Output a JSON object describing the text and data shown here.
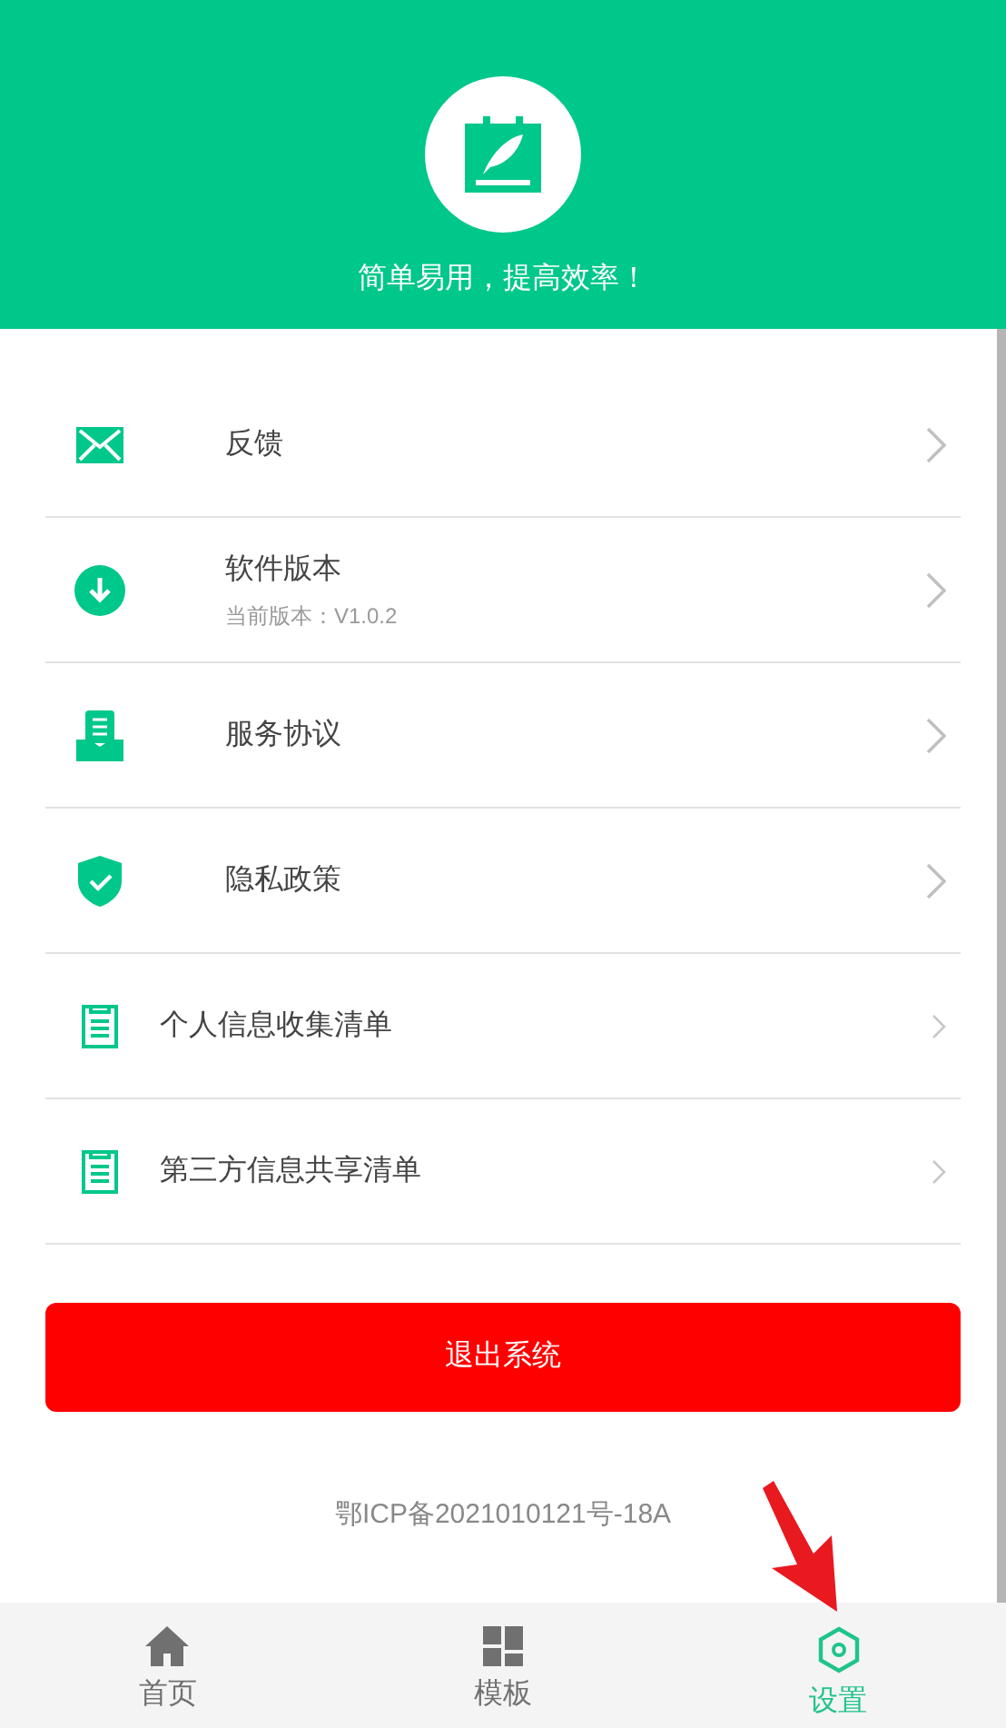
{
  "header": {
    "slogan": "简单易用，提高效率！"
  },
  "menu": [
    {
      "kind": "large",
      "label": "反馈"
    },
    {
      "kind": "large",
      "label": "软件版本",
      "subtitle": "当前版本：V1.0.2"
    },
    {
      "kind": "large",
      "label": "服务协议"
    },
    {
      "kind": "large",
      "label": "隐私政策"
    },
    {
      "kind": "compact",
      "label": "个人信息收集清单"
    },
    {
      "kind": "compact",
      "label": "第三方信息共享清单"
    }
  ],
  "logout_button": "退出系统",
  "footer": {
    "icp": "鄂ICP备2021010121号-18A"
  },
  "tab_bar": [
    {
      "label": "首页",
      "selected": false
    },
    {
      "label": "模板",
      "selected": false
    },
    {
      "label": "设置",
      "selected": true
    }
  ]
}
